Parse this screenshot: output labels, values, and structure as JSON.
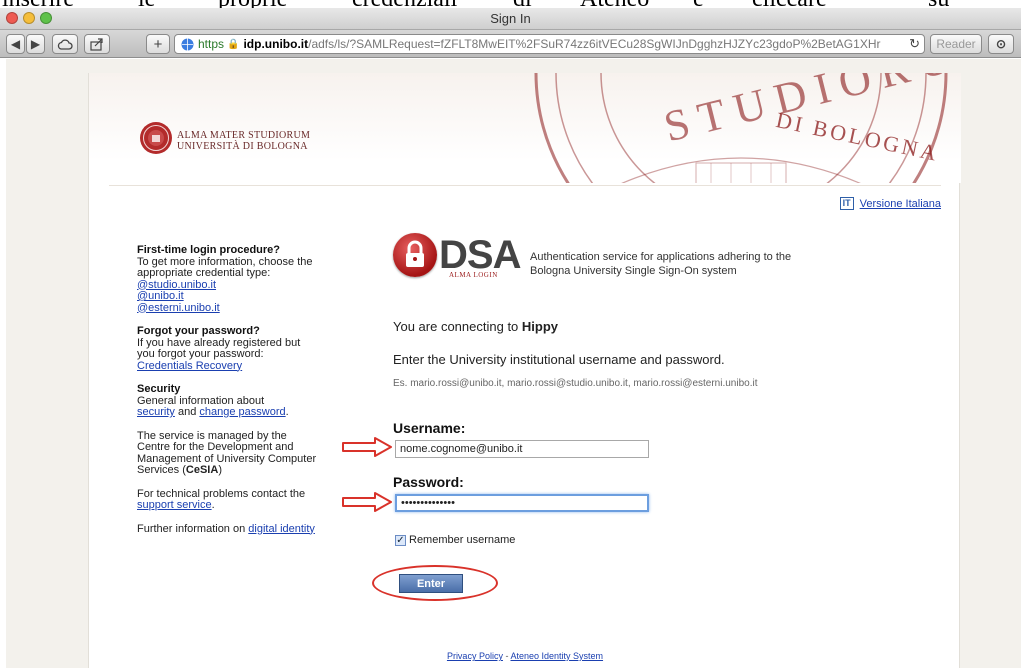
{
  "caption": {
    "words": [
      "inserire",
      "le",
      "proprie",
      "credenziali",
      "di",
      "Ateneo",
      "e",
      "cliccare",
      "su"
    ]
  },
  "window": {
    "title": "Sign In"
  },
  "toolbar": {
    "url_scheme": "https",
    "url_host": "idp.unibo.it",
    "url_path": "/adfs/ls/?SAMLRequest=fZFLT8MwEIT%2FSuR74zz6itVECu28SgWIJnDgghzHJZYc23gdoP%2BetAG1XHr",
    "reader_label": "Reader"
  },
  "header": {
    "university_line1": "ALMA MATER STUDIORUM",
    "university_line2": "UNIVERSITÀ DI BOLOGNA",
    "seal_text_top": "STUDIORUM",
    "seal_text_inner": "DI BOLOGNA"
  },
  "language": {
    "flag": "IT",
    "link": "Versione Italiana"
  },
  "sidebar": {
    "first_time_title": "First-time login procedure?",
    "first_time_text": "To get more information, choose the appropriate credential type:",
    "links": [
      "@studio.unibo.it",
      "@unibo.it",
      "@esterni.unibo.it"
    ],
    "forgot_title": "Forgot your password?",
    "forgot_text": "If you have already registered but you forgot your password:",
    "forgot_link": "Credentials Recovery",
    "security_title": "Security",
    "security_text": "General information about",
    "security_link1": "security",
    "security_and": "and",
    "security_link2": "change password",
    "managed_text": "The service is managed by the Centre for the Development and Management of University Computer Services (",
    "managed_bold": "CeSIA",
    "managed_end": ")",
    "problems_text": "For technical problems contact the",
    "problems_link": "support service",
    "further_text": "Further information on",
    "further_link": "digital identity"
  },
  "dsa": {
    "word": "DSA",
    "subtitle": "ALMA LOGIN",
    "desc_line1": "Authentication service for applications adhering to the",
    "desc_line2": "Bologna University Single Sign-On system"
  },
  "form": {
    "connecting_prefix": "You are connecting to",
    "connecting_app": "Hippy",
    "instruction": "Enter the University institutional username and password.",
    "example": "Es. mario.rossi@unibo.it, mario.rossi@studio.unibo.it, mario.rossi@esterni.unibo.it",
    "username_label": "Username:",
    "username_value": "nome.cognome@unibo.it",
    "password_label": "Password:",
    "password_value": "••••••••••••••",
    "remember_label": "Remember username",
    "remember_checked": true,
    "enter_label": "Enter"
  },
  "footer": {
    "privacy": "Privacy Policy",
    "separator": "-",
    "identity": "Ateneo Identity System"
  },
  "colors": {
    "annotation_red": "#d9322a",
    "link_blue": "#1a3fb0",
    "button_blue": "#4a6ea8"
  }
}
